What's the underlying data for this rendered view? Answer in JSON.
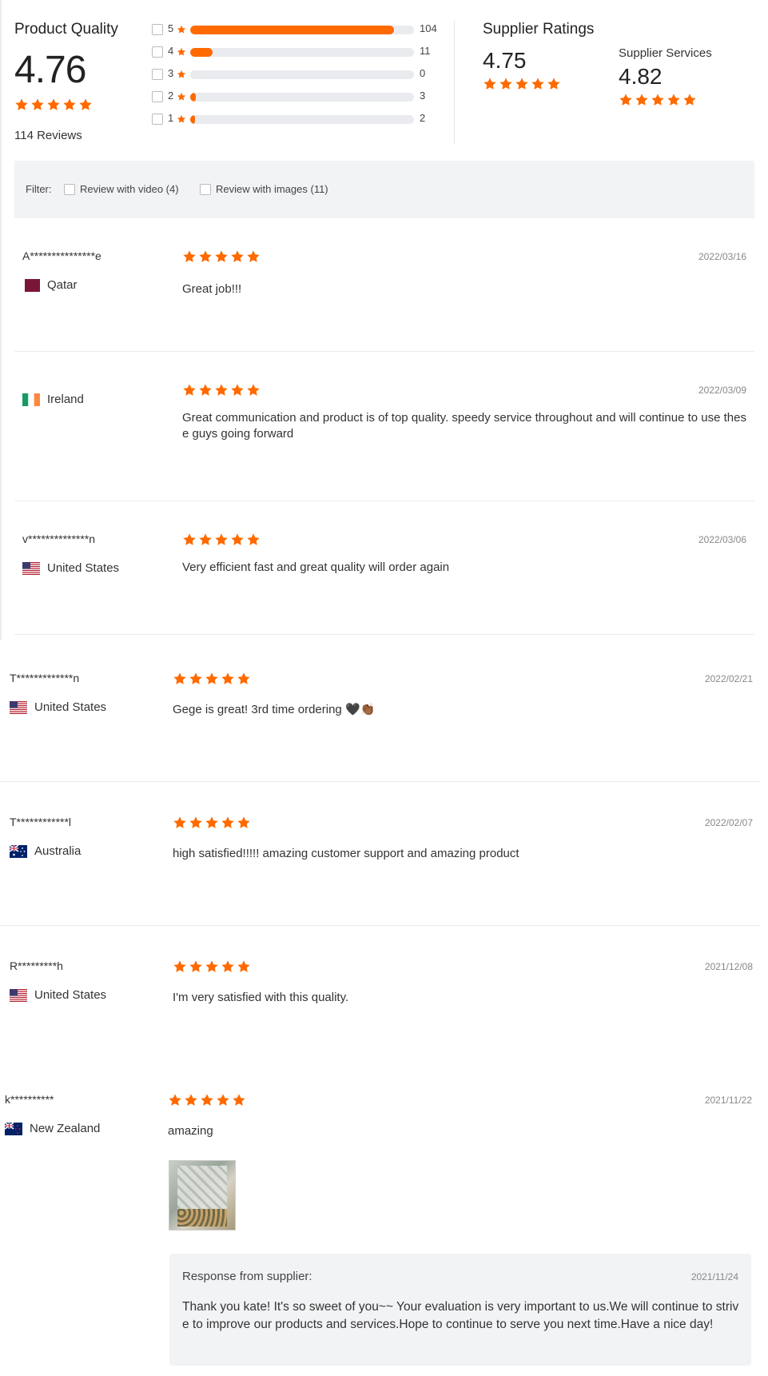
{
  "summary": {
    "product_quality_title": "Product Quality",
    "product_quality_score": "4.76",
    "product_quality_rating": 4.76,
    "review_count_text": "114 Reviews",
    "distribution": [
      {
        "stars": "5",
        "count": "104",
        "fraction": 0.91
      },
      {
        "stars": "4",
        "count": "11",
        "fraction": 0.1
      },
      {
        "stars": "3",
        "count": "0",
        "fraction": 0.0
      },
      {
        "stars": "2",
        "count": "3",
        "fraction": 0.026
      },
      {
        "stars": "1",
        "count": "2",
        "fraction": 0.018
      }
    ],
    "supplier_ratings_title": "Supplier Ratings",
    "supplier_ratings_score": "4.75",
    "supplier_services_title": "Supplier Services",
    "supplier_services_score": "4.82"
  },
  "filter": {
    "label": "Filter:",
    "video_option": "Review with video (4)",
    "images_option": "Review with images (11)"
  },
  "reviews": [
    {
      "name": "A***************e",
      "country": "Qatar",
      "flag": "qatar-flag",
      "date": "2022/03/16",
      "text": "Great job!!!",
      "stars": 5
    },
    {
      "name": "",
      "country": "Ireland",
      "flag": "ireland-flag",
      "date": "2022/03/09",
      "text": "Great communication and product is of top quality. speedy service throughout and will continue to use these guys going forward",
      "stars": 5
    },
    {
      "name": "v**************n",
      "country": "United States",
      "flag": "us-flag",
      "date": "2022/03/06",
      "text": "Very efficient fast and great quality will order again",
      "stars": 5
    },
    {
      "name": "T*************n",
      "country": "United States",
      "flag": "us-flag",
      "date": "2022/02/21",
      "text": "Gege is great! 3rd time ordering 🖤👏🏾",
      "stars": 5
    },
    {
      "name": "T************l",
      "country": "Australia",
      "flag": "australia-flag",
      "date": "2022/02/07",
      "text": "high satisfied!!!!! amazing customer support and amazing product",
      "stars": 5
    },
    {
      "name": "R*********h",
      "country": "United States",
      "flag": "us-flag",
      "date": "2021/12/08",
      "text": "I'm very satisfied with this quality.",
      "stars": 5
    },
    {
      "name": "k**********",
      "country": "New Zealand",
      "flag": "new-zealand-flag",
      "date": "2021/11/22",
      "text": "amazing",
      "stars": 5
    }
  ],
  "supplier_response": {
    "title": "Response from supplier:",
    "date": "2021/11/24",
    "text": "Thank you kate!    It's so sweet of you~~ Your evaluation is very important to us.We will continue to strive to improve our products and services.Hope to continue to serve you next time.Have a nice day!"
  },
  "colors": {
    "accent": "#ff6a00",
    "track": "#e9ebef",
    "filter_bg": "#f2f3f5"
  }
}
